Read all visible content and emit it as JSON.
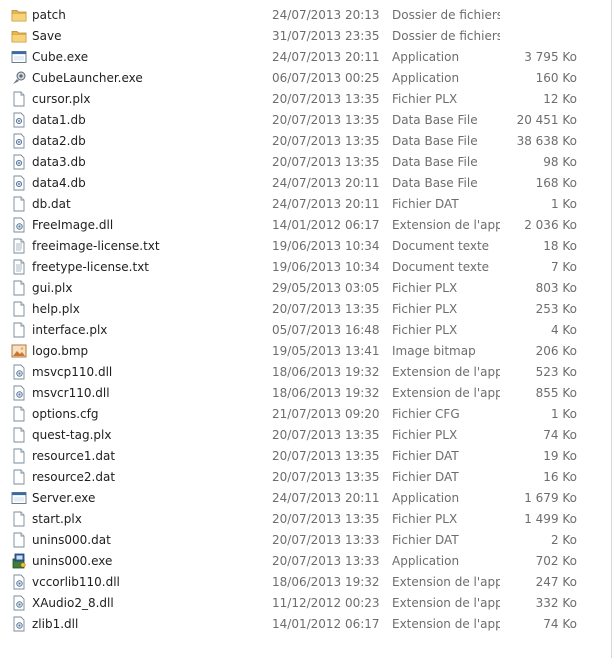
{
  "files": [
    {
      "name": "patch",
      "date": "24/07/2013 20:13",
      "type": "Dossier de fichiers",
      "size": "",
      "icon": "folder-icon"
    },
    {
      "name": "Save",
      "date": "31/07/2013 23:35",
      "type": "Dossier de fichiers",
      "size": "",
      "icon": "folder-icon"
    },
    {
      "name": "Cube.exe",
      "date": "24/07/2013 20:11",
      "type": "Application",
      "size": "3 795 Ko",
      "icon": "application-window-icon"
    },
    {
      "name": "CubeLauncher.exe",
      "date": "06/07/2013 00:25",
      "type": "Application",
      "size": "160 Ko",
      "icon": "launcher-icon"
    },
    {
      "name": "cursor.plx",
      "date": "20/07/2013 13:35",
      "type": "Fichier PLX",
      "size": "12 Ko",
      "icon": "blank-file-icon"
    },
    {
      "name": "data1.db",
      "date": "20/07/2013 13:35",
      "type": "Data Base File",
      "size": "20 451 Ko",
      "icon": "database-file-icon"
    },
    {
      "name": "data2.db",
      "date": "20/07/2013 13:35",
      "type": "Data Base File",
      "size": "38 638 Ko",
      "icon": "database-file-icon"
    },
    {
      "name": "data3.db",
      "date": "20/07/2013 13:35",
      "type": "Data Base File",
      "size": "98 Ko",
      "icon": "database-file-icon"
    },
    {
      "name": "data4.db",
      "date": "24/07/2013 20:11",
      "type": "Data Base File",
      "size": "168 Ko",
      "icon": "database-file-icon"
    },
    {
      "name": "db.dat",
      "date": "24/07/2013 20:11",
      "type": "Fichier DAT",
      "size": "1 Ko",
      "icon": "blank-file-icon"
    },
    {
      "name": "FreeImage.dll",
      "date": "14/01/2012 06:17",
      "type": "Extension de l'app...",
      "size": "2 036 Ko",
      "icon": "dll-file-icon"
    },
    {
      "name": "freeimage-license.txt",
      "date": "19/06/2013 10:34",
      "type": "Document texte",
      "size": "18 Ko",
      "icon": "text-file-icon"
    },
    {
      "name": "freetype-license.txt",
      "date": "19/06/2013 10:34",
      "type": "Document texte",
      "size": "7 Ko",
      "icon": "text-file-icon"
    },
    {
      "name": "gui.plx",
      "date": "29/05/2013 03:05",
      "type": "Fichier PLX",
      "size": "803 Ko",
      "icon": "blank-file-icon"
    },
    {
      "name": "help.plx",
      "date": "20/07/2013 13:35",
      "type": "Fichier PLX",
      "size": "253 Ko",
      "icon": "blank-file-icon"
    },
    {
      "name": "interface.plx",
      "date": "05/07/2013 16:48",
      "type": "Fichier PLX",
      "size": "4 Ko",
      "icon": "blank-file-icon"
    },
    {
      "name": "logo.bmp",
      "date": "19/05/2013 13:41",
      "type": "Image bitmap",
      "size": "206 Ko",
      "icon": "bitmap-image-icon"
    },
    {
      "name": "msvcp110.dll",
      "date": "18/06/2013 19:32",
      "type": "Extension de l'app...",
      "size": "523 Ko",
      "icon": "dll-file-icon"
    },
    {
      "name": "msvcr110.dll",
      "date": "18/06/2013 19:32",
      "type": "Extension de l'app...",
      "size": "855 Ko",
      "icon": "dll-file-icon"
    },
    {
      "name": "options.cfg",
      "date": "21/07/2013 09:20",
      "type": "Fichier CFG",
      "size": "1 Ko",
      "icon": "blank-file-icon"
    },
    {
      "name": "quest-tag.plx",
      "date": "20/07/2013 13:35",
      "type": "Fichier PLX",
      "size": "74 Ko",
      "icon": "blank-file-icon"
    },
    {
      "name": "resource1.dat",
      "date": "20/07/2013 13:35",
      "type": "Fichier DAT",
      "size": "19 Ko",
      "icon": "blank-file-icon"
    },
    {
      "name": "resource2.dat",
      "date": "20/07/2013 13:35",
      "type": "Fichier DAT",
      "size": "16 Ko",
      "icon": "blank-file-icon"
    },
    {
      "name": "Server.exe",
      "date": "24/07/2013 20:11",
      "type": "Application",
      "size": "1 679 Ko",
      "icon": "application-window-icon"
    },
    {
      "name": "start.plx",
      "date": "20/07/2013 13:35",
      "type": "Fichier PLX",
      "size": "1 499 Ko",
      "icon": "blank-file-icon"
    },
    {
      "name": "unins000.dat",
      "date": "20/07/2013 13:33",
      "type": "Fichier DAT",
      "size": "2 Ko",
      "icon": "blank-file-icon"
    },
    {
      "name": "unins000.exe",
      "date": "20/07/2013 13:33",
      "type": "Application",
      "size": "702 Ko",
      "icon": "installer-icon"
    },
    {
      "name": "vccorlib110.dll",
      "date": "18/06/2013 19:32",
      "type": "Extension de l'app...",
      "size": "247 Ko",
      "icon": "dll-file-icon"
    },
    {
      "name": "XAudio2_8.dll",
      "date": "11/12/2012 00:23",
      "type": "Extension de l'app...",
      "size": "332 Ko",
      "icon": "dll-file-icon"
    },
    {
      "name": "zlib1.dll",
      "date": "14/01/2012 06:17",
      "type": "Extension de l'app...",
      "size": "74 Ko",
      "icon": "dll-file-icon"
    }
  ]
}
